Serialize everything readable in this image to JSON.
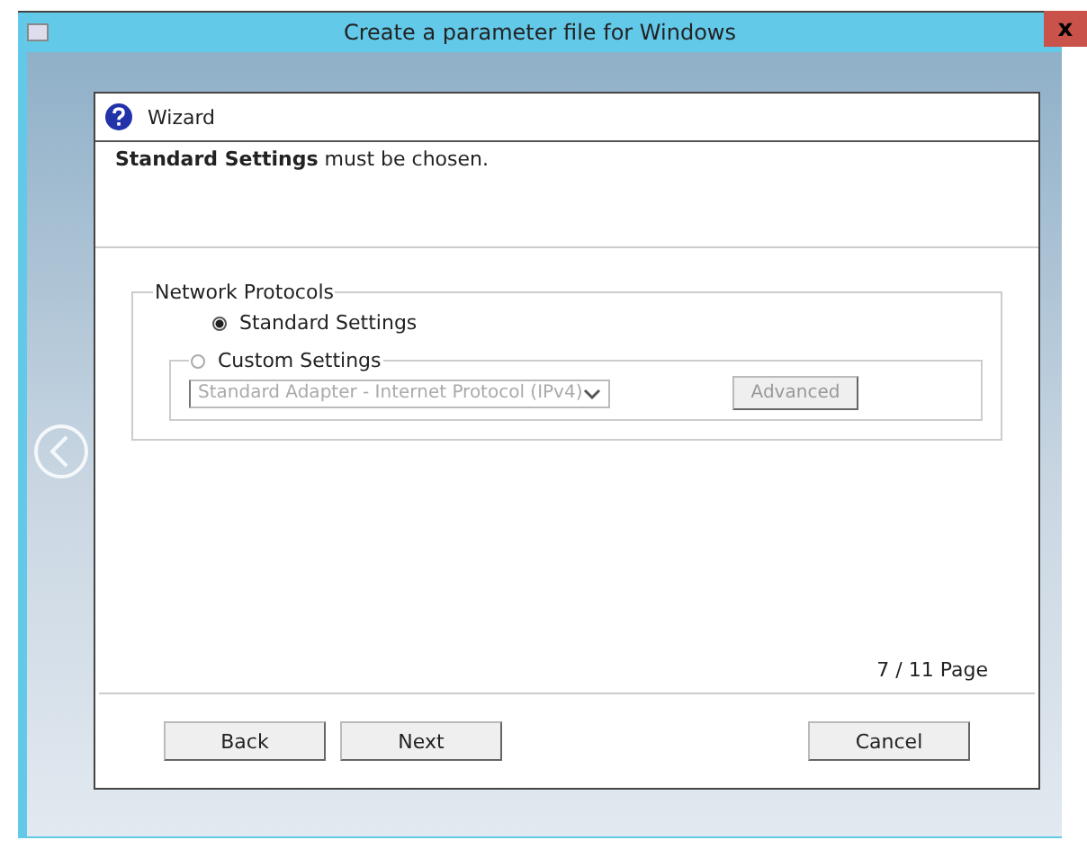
{
  "window": {
    "title": "Create a parameter file for Windows",
    "close_label": "x"
  },
  "dialog": {
    "title": "Wizard",
    "message": "**Standard Settings** must be chosen.",
    "group": {
      "title": "Network Protocols",
      "options": [
        {
          "label": "Standard Settings",
          "selected": true
        },
        {
          "label": "Custom Settings",
          "selected": false
        }
      ],
      "adapter": {
        "value": "Standard Adapter - Internet Protocol (IPv4)",
        "disabled": true
      },
      "advanced_button": {
        "label": "Advanced",
        "disabled": true
      }
    },
    "page_indicator": "7 / 11 Page",
    "buttons": [
      "Back",
      "Next",
      "Cancel"
    ]
  }
}
